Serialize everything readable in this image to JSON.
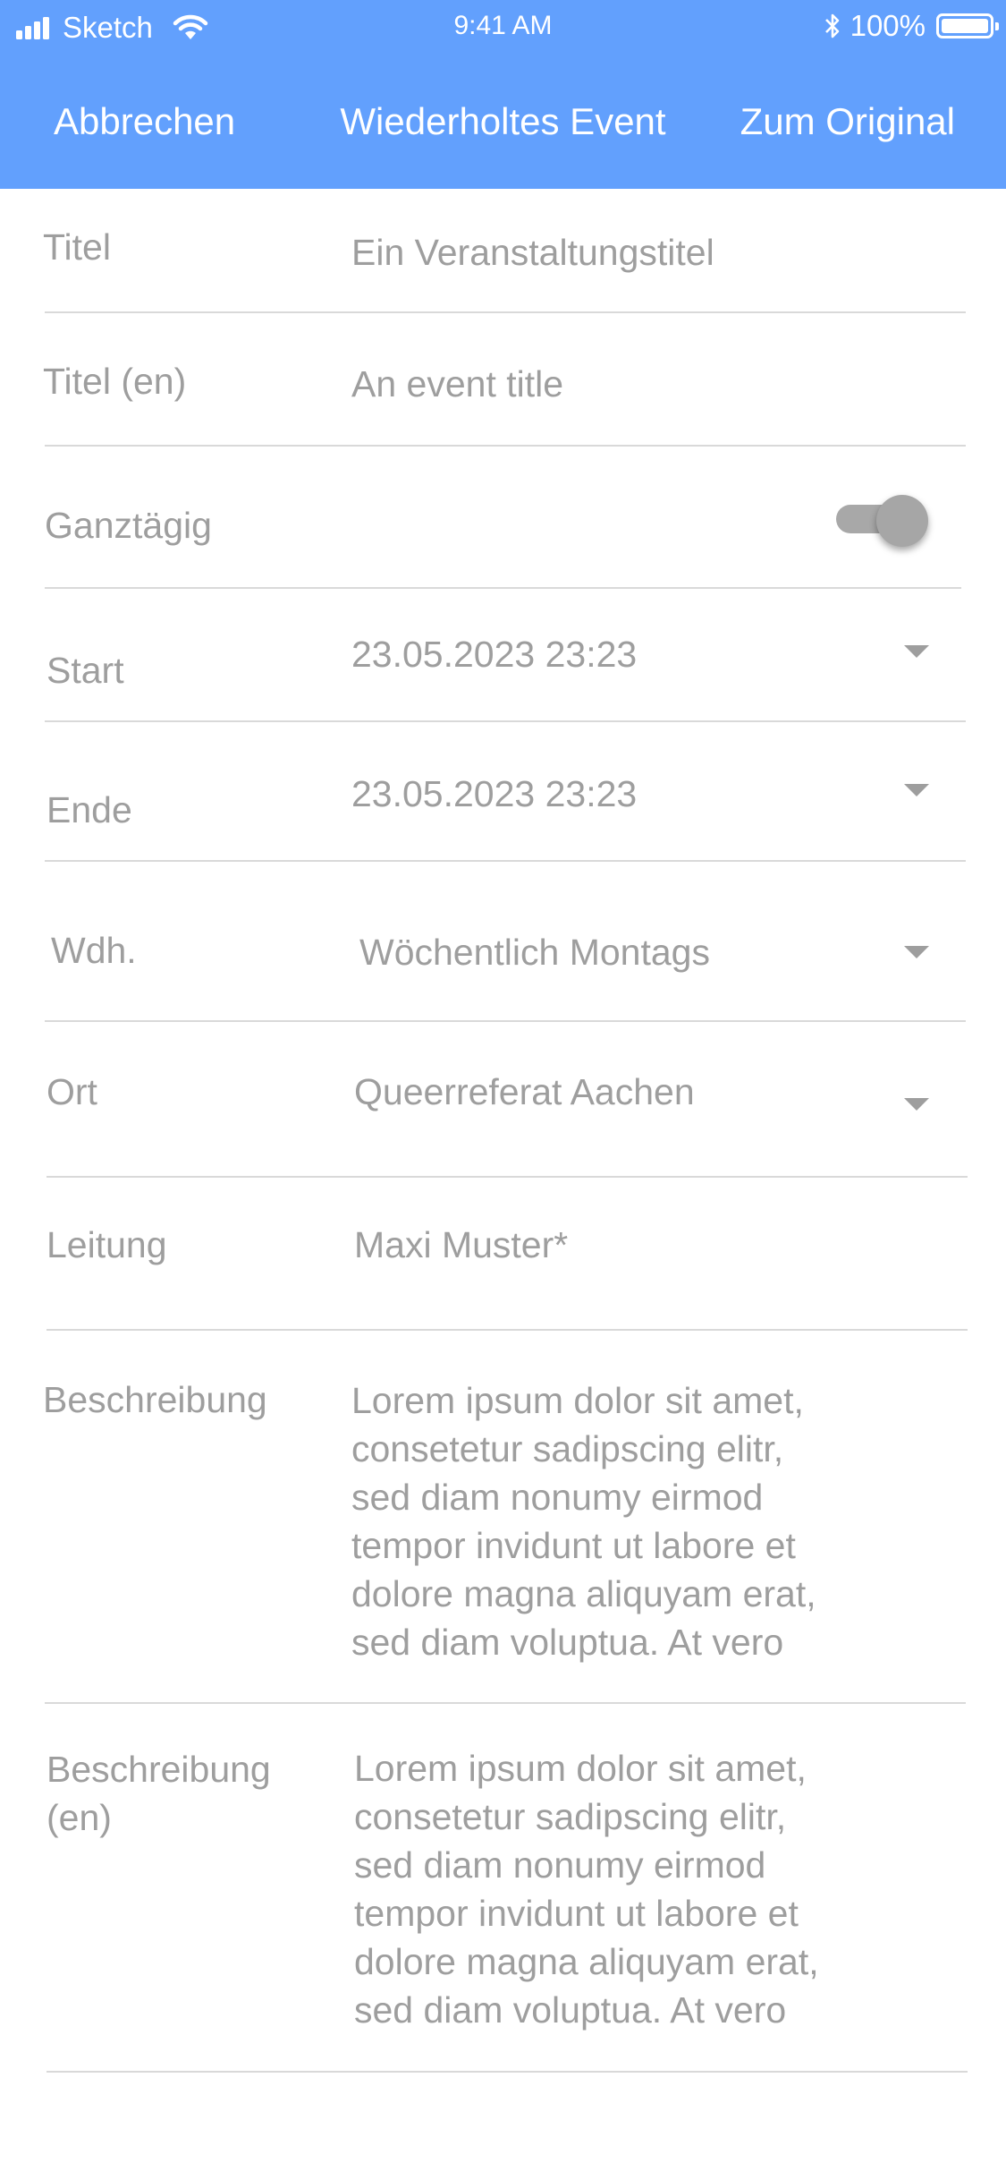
{
  "status_bar": {
    "carrier": "Sketch",
    "time": "9:41 AM",
    "battery": "100%"
  },
  "nav": {
    "cancel": "Abbrechen",
    "title": "Wiederholtes Event",
    "original": "Zum Original"
  },
  "form": {
    "title": {
      "label": "Titel",
      "placeholder": "Ein Veranstaltungstitel"
    },
    "title_en": {
      "label": "Titel (en)",
      "placeholder": "An event title"
    },
    "all_day": {
      "label": "Ganztägig"
    },
    "start": {
      "label": "Start",
      "value": "23.05.2023 23:23"
    },
    "end": {
      "label": "Ende",
      "value": "23.05.2023 23:23"
    },
    "repeat": {
      "label": "Wdh.",
      "value": "Wöchentlich Montags"
    },
    "location": {
      "label": "Ort",
      "value": "Queerreferat Aachen"
    },
    "lead": {
      "label": "Leitung",
      "value": "Maxi Muster*"
    },
    "description": {
      "label": "Beschreibung",
      "lines": [
        "Lorem ipsum dolor sit amet,",
        "consetetur sadipscing elitr,",
        "sed diam nonumy eirmod",
        "tempor invidunt ut labore et",
        "dolore magna aliquyam erat,",
        "sed diam voluptua. At vero"
      ]
    },
    "description_en": {
      "label_line1": "Beschreibung",
      "label_line2": "(en)",
      "lines": [
        "Lorem ipsum dolor sit amet,",
        "consetetur sadipscing elitr,",
        "sed diam nonumy eirmod",
        "tempor invidunt ut labore et",
        "dolore magna aliquyam erat,",
        "sed diam voluptua. At vero"
      ]
    }
  },
  "colors": {
    "header": "#62a0fd",
    "text": "#9e9e9e",
    "divider": "#d9d9d9"
  }
}
